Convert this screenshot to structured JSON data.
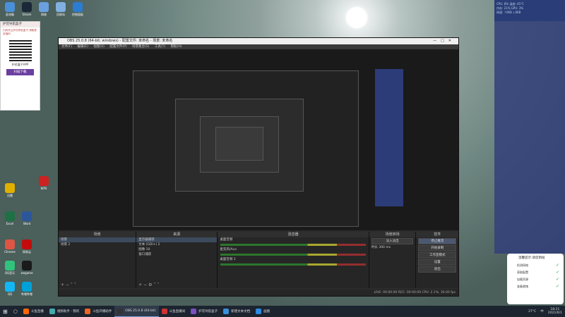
{
  "desktop": {
    "icons": [
      {
        "label": "此电脑",
        "color": "#4a90d9"
      },
      {
        "label": "Steam",
        "color": "#1b2838"
      },
      {
        "label": "网络",
        "color": "#6aa0e0"
      },
      {
        "label": "回收站",
        "color": "#7fb0e0"
      },
      {
        "label": "控制面板",
        "color": "#2b7cd3"
      },
      {
        "label": "迅雷",
        "color": "#e0b000"
      },
      {
        "label": "Excel",
        "color": "#1e7145"
      },
      {
        "label": "Word",
        "color": "#2b579a"
      },
      {
        "label": "Chrome",
        "color": "#d54"
      },
      {
        "label": "网易云",
        "color": "#c20c0c"
      },
      {
        "label": "QQ音乐",
        "color": "#31c27c"
      },
      {
        "label": "wegame",
        "color": "#1a1a1a"
      },
      {
        "label": "QQ",
        "color": "#12b7f5"
      },
      {
        "label": "哔哩哔哩",
        "color": "#00a1d6"
      },
      {
        "label": "WPS",
        "color": "#c22"
      }
    ]
  },
  "popup": {
    "title": "护花导航盒子",
    "text": "扫码关注护花导航盒子,领取更多福利",
    "qr_label": "护花盒子APP",
    "button": "扫描下载"
  },
  "obs": {
    "title": "OBS 25.0.8 (64-bit, windows) - 配置文件: 未命名 - 场景: 未命名",
    "menus": [
      "文件(F)",
      "编辑(E)",
      "视图(V)",
      "配置文件(P)",
      "场景集合(S)",
      "工具(T)",
      "帮助(H)"
    ],
    "scenes": {
      "header": "场景",
      "items": [
        "场景",
        "场景 2"
      ]
    },
    "sources": {
      "header": "来源",
      "items": [
        "显示器捕获",
        "文本 (GDI+) 2",
        "图像 10",
        "窗口捕获"
      ]
    },
    "mixer": {
      "header": "混音器",
      "channels": [
        "桌面音频",
        "麦克风/Aux",
        "桌面音频 2"
      ],
      "db": "0.0 dB"
    },
    "transitions": {
      "header": "场景转场",
      "type": "淡入淡出",
      "duration_label": "时长",
      "duration": "300 ms"
    },
    "controls": {
      "header": "控件",
      "buttons": [
        "停止推流",
        "开始录制",
        "工作室模式",
        "设置",
        "退出"
      ]
    },
    "status": "LIVE: 00:00:00   REC: 00:00:00   CPU: 2.1%, 30.00 fps"
  },
  "sysmon": {
    "lines": [
      "CPU: 8%  温度: 45°C",
      "内存: 21%  GPU: 3%",
      "网速: ↑0KB ↓0KB"
    ]
  },
  "notification": {
    "title": "温馨提示:请您稍候",
    "items": [
      "检测网络",
      "获取配置",
      "加载资源",
      "准备就绪"
    ]
  },
  "taskbar": {
    "items": [
      {
        "label": "斗鱼直播",
        "color": "#f60"
      },
      {
        "label": "视频助手 - 我的",
        "color": "#4aa"
      },
      {
        "label": "斗鱼开播助手",
        "color": "#e62"
      },
      {
        "label": "OBS 25.0.8 (64-bit)",
        "color": "#333",
        "active": true
      },
      {
        "label": "斗鱼直播间",
        "color": "#c33"
      },
      {
        "label": "护花导航盒子",
        "color": "#7a4fc0"
      },
      {
        "label": "新建文本文档",
        "color": "#3a8fd8"
      },
      {
        "label": "画图",
        "color": "#2d8ae0"
      }
    ],
    "tray": {
      "weather": "27°C",
      "ime": "中",
      "time": "18:21",
      "date": "2021/6/1"
    }
  }
}
